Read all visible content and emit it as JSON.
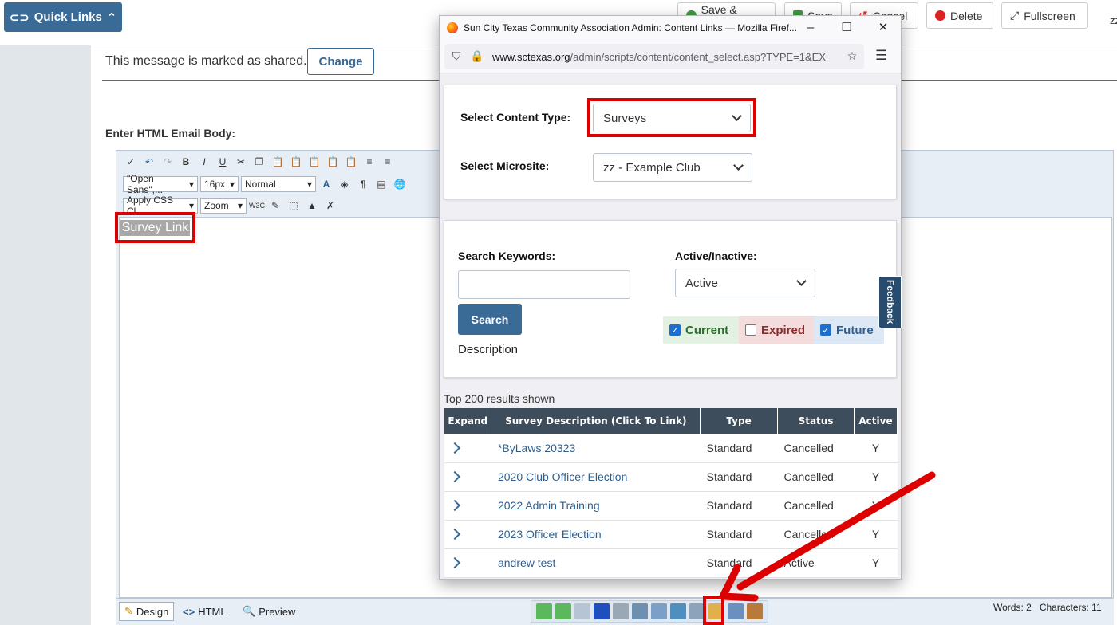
{
  "header": {
    "quick_links_label": "Quick Links",
    "buttons": {
      "save_close": "Save & Close",
      "save": "Save",
      "cancel": "Cancel",
      "delete": "Delete",
      "fullscreen": "Fullscreen"
    },
    "user_initials": "zz"
  },
  "form": {
    "shared_message": "This message is marked as shared.",
    "change_label": "Change",
    "html_body_label": "Enter HTML Email Body:"
  },
  "editor": {
    "font_select": "\"Open Sans\",...",
    "size_select": "16px",
    "format_select": "Normal",
    "css_select": "Apply CSS Cl...",
    "zoom_select": "Zoom",
    "content_text": "Survey Link",
    "tabs": {
      "design": "Design",
      "html": "HTML",
      "preview": "Preview"
    },
    "words": "Words: 2",
    "characters": "Characters: 11"
  },
  "popup": {
    "title": "Sun City Texas Community Association Admin: Content Links — Mozilla Firef...",
    "url_domain": "www.sctexas.org",
    "url_path": "/admin/scripts/content/content_select.asp?TYPE=1&EX",
    "content_type_label": "Select Content Type:",
    "content_type_value": "Surveys",
    "microsite_label": "Select Microsite:",
    "microsite_value": "zz - Example Club",
    "keywords_label": "Search Keywords:",
    "keywords_value": "",
    "active_label": "Active/Inactive:",
    "active_value": "Active",
    "search_button": "Search",
    "description_label": "Description",
    "filters": [
      {
        "label": "Current",
        "checked": true,
        "color": "#e3f1e3",
        "text_color": "#2c6e2c"
      },
      {
        "label": "Expired",
        "checked": false,
        "color": "#f5dcdc",
        "text_color": "#8a2b2b"
      },
      {
        "label": "Future",
        "checked": true,
        "color": "#dce8f5",
        "text_color": "#2f5f8f"
      }
    ],
    "feedback_label": "Feedback",
    "results_note": "Top 200 results shown",
    "columns": [
      "Expand",
      "Survey Description (Click To Link)",
      "Type",
      "Status",
      "Active"
    ],
    "rows": [
      {
        "description": "*ByLaws 20323",
        "type": "Standard",
        "status": "Cancelled",
        "active": "Y"
      },
      {
        "description": "2020 Club Officer Election",
        "type": "Standard",
        "status": "Cancelled",
        "active": "Y"
      },
      {
        "description": "2022 Admin Training",
        "type": "Standard",
        "status": "Cancelled",
        "active": "Y"
      },
      {
        "description": "2023 Officer Election",
        "type": "Standard",
        "status": "Cancelled",
        "active": "Y"
      },
      {
        "description": "andrew test",
        "type": "Standard",
        "status": "Active",
        "active": "Y"
      }
    ]
  },
  "colors": {
    "primary": "#3a6a96",
    "annotation_red": "#dd0000",
    "table_header": "#3d4d5c"
  }
}
